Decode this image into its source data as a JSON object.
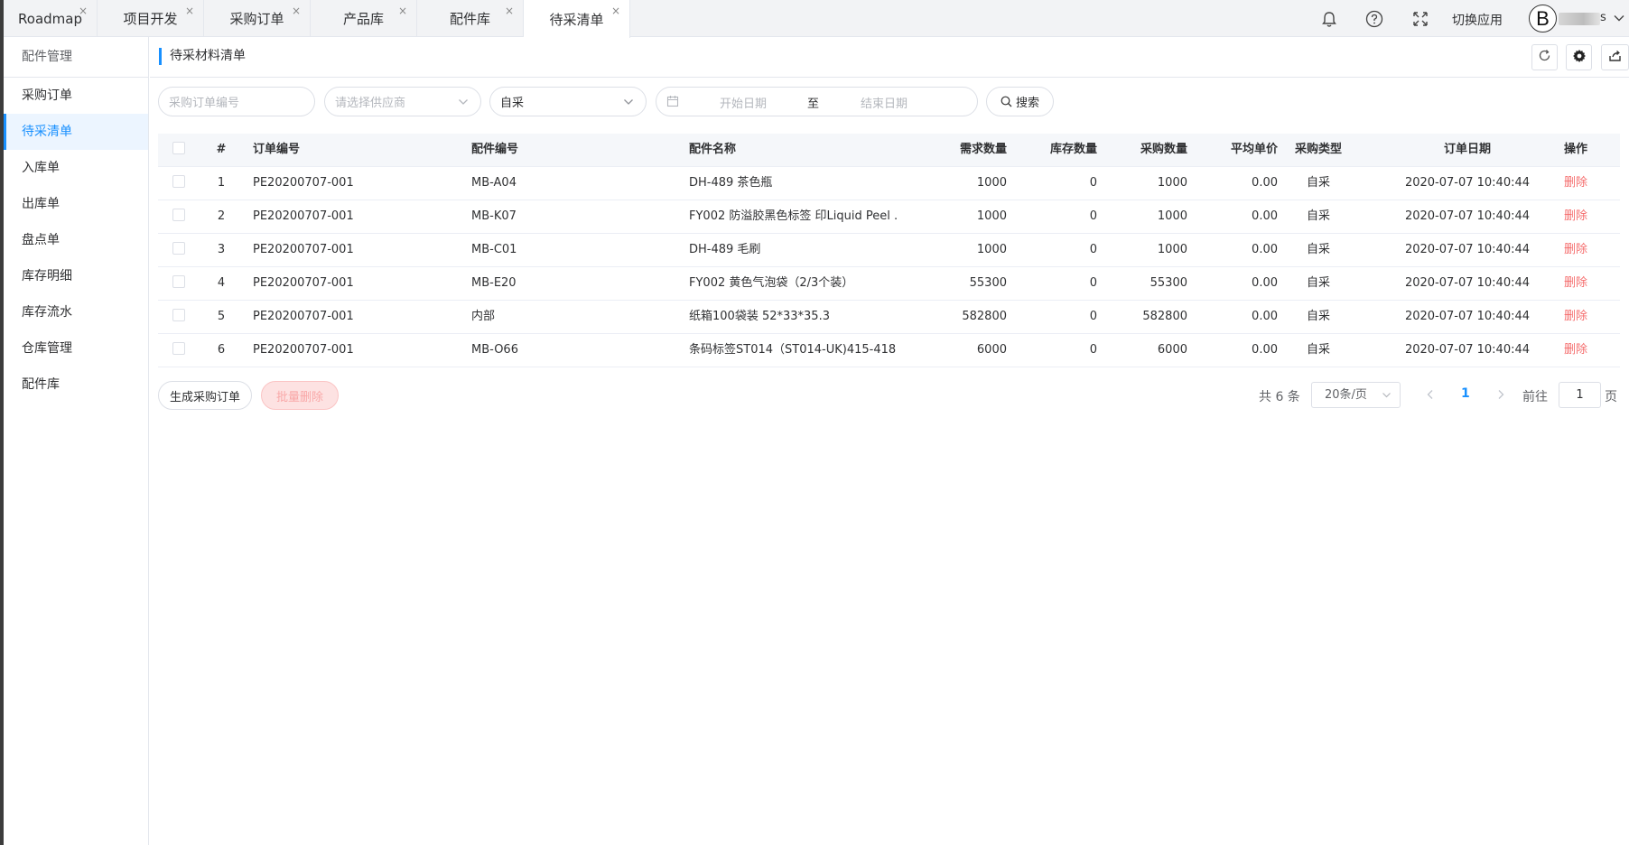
{
  "tabs": [
    {
      "label": "Roadmap",
      "active": false
    },
    {
      "label": "项目开发",
      "active": false
    },
    {
      "label": "采购订单",
      "active": false
    },
    {
      "label": "产品库",
      "active": false
    },
    {
      "label": "配件库",
      "active": false
    },
    {
      "label": "待采清单",
      "active": true
    }
  ],
  "tab_close_glyph": "×",
  "header": {
    "switch_app": "切换应用",
    "avatar_letter": "B",
    "username_tail": "s",
    "icons": [
      "bell-icon",
      "help-icon",
      "fullscreen-icon",
      "chevron-down-icon"
    ]
  },
  "sidebar": {
    "title": "配件管理",
    "items": [
      {
        "label": "采购订单",
        "active": false
      },
      {
        "label": "待采清单",
        "active": true
      },
      {
        "label": "入库单",
        "active": false
      },
      {
        "label": "出库单",
        "active": false
      },
      {
        "label": "盘点单",
        "active": false
      },
      {
        "label": "库存明细",
        "active": false
      },
      {
        "label": "库存流水",
        "active": false
      },
      {
        "label": "仓库管理",
        "active": false
      },
      {
        "label": "配件库",
        "active": false
      }
    ]
  },
  "page": {
    "title": "待采材料清单",
    "toolbar_icons": [
      "refresh-icon",
      "gear-icon",
      "export-icon"
    ]
  },
  "filters": {
    "order_no_placeholder": "采购订单编号",
    "supplier_placeholder": "请选择供应商",
    "type_value": "自采",
    "start_date_placeholder": "开始日期",
    "date_separator": "至",
    "end_date_placeholder": "结束日期",
    "search_label": "搜索"
  },
  "table": {
    "columns": [
      "#",
      "订单编号",
      "配件编号",
      "配件名称",
      "需求数量",
      "库存数量",
      "采购数量",
      "平均单价",
      "采购类型",
      "订单日期",
      "操作"
    ],
    "rows": [
      {
        "index": "1",
        "order_no": "PE20200707-001",
        "part_no": "MB-A04",
        "part_name": "DH-489 茶色瓶",
        "demand": "1000",
        "stock": "0",
        "purchase": "1000",
        "avg_price": "0.00",
        "type": "自采",
        "date": "2020-07-07 10:40:44",
        "action": "删除"
      },
      {
        "index": "2",
        "order_no": "PE20200707-001",
        "part_no": "MB-K07",
        "part_name": "FY002 防溢胶黑色标签 印Liquid Peel ...",
        "demand": "1000",
        "stock": "0",
        "purchase": "1000",
        "avg_price": "0.00",
        "type": "自采",
        "date": "2020-07-07 10:40:44",
        "action": "删除"
      },
      {
        "index": "3",
        "order_no": "PE20200707-001",
        "part_no": "MB-C01",
        "part_name": "DH-489 毛刷",
        "demand": "1000",
        "stock": "0",
        "purchase": "1000",
        "avg_price": "0.00",
        "type": "自采",
        "date": "2020-07-07 10:40:44",
        "action": "删除"
      },
      {
        "index": "4",
        "order_no": "PE20200707-001",
        "part_no": "MB-E20",
        "part_name": "FY002 黄色气泡袋（2/3个装）",
        "demand": "55300",
        "stock": "0",
        "purchase": "55300",
        "avg_price": "0.00",
        "type": "自采",
        "date": "2020-07-07 10:40:44",
        "action": "删除"
      },
      {
        "index": "5",
        "order_no": "PE20200707-001",
        "part_no": "内部",
        "part_name": "纸箱100袋装 52*33*35.3",
        "demand": "582800",
        "stock": "0",
        "purchase": "582800",
        "avg_price": "0.00",
        "type": "自采",
        "date": "2020-07-07 10:40:44",
        "action": "删除"
      },
      {
        "index": "6",
        "order_no": "PE20200707-001",
        "part_no": "MB-O66",
        "part_name": "条码标签ST014（ST014-UK)415-418...",
        "demand": "6000",
        "stock": "0",
        "purchase": "6000",
        "avg_price": "0.00",
        "type": "自采",
        "date": "2020-07-07 10:40:44",
        "action": "删除"
      }
    ]
  },
  "actions": {
    "generate_order": "生成采购订单",
    "batch_delete": "批量删除"
  },
  "pagination": {
    "total": "共 6 条",
    "page_size": "20条/页",
    "current_page": "1",
    "goto_label": "前往",
    "goto_value": "1",
    "page_unit": "页"
  },
  "colors": {
    "accent": "#1890ff",
    "danger": "#f56c6c",
    "danger_bg": "#fde2e2"
  }
}
